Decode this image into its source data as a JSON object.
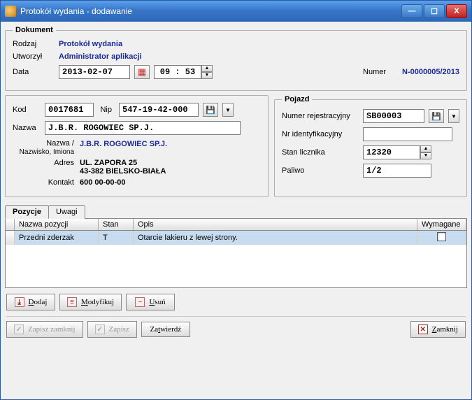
{
  "window": {
    "title": "Protokół wydania - dodawanie"
  },
  "winbuttons": {
    "min": "—",
    "max": "☐",
    "close": "X"
  },
  "dokument": {
    "legend": "Dokument",
    "rodzaj_lbl": "Rodzaj",
    "rodzaj_val": "Protokół wydania",
    "utworzyl_lbl": "Utworzył",
    "utworzyl_val": "Administrator aplikacji",
    "data_lbl": "Data",
    "data_val": "2013-02-07",
    "godz_val": "09 : 53",
    "numer_lbl": "Numer",
    "numer_val": "N-0000005/2013"
  },
  "klient": {
    "kod_lbl": "Kod",
    "kod_val": "0017681",
    "nip_lbl": "Nip",
    "nip_val": "547-19-42-000",
    "nazwa_lbl": "Nazwa",
    "nazwa_val": "J.B.R. ROGOWIEC SP.J.",
    "nazwisko_lbl1": "Nazwa /",
    "nazwisko_lbl2": "Nazwisko, Imiona",
    "nazwisko_val": "J.B.R. ROGOWIEC SP.J.",
    "adres_lbl": "Adres",
    "adres_l1": "UL. ZAPORA 25",
    "adres_l2": "43-382 BIELSKO-BIAŁA",
    "kontakt_lbl": "Kontakt",
    "kontakt_val": "600 00-00-00"
  },
  "pojazd": {
    "legend": "Pojazd",
    "rej_lbl": "Numer rejestracyjny",
    "rej_val": "SB00003",
    "ident_lbl": "Nr identyfikacyjny",
    "ident_val": "",
    "stan_lbl": "Stan licznika",
    "stan_val": "12320",
    "paliwo_lbl": "Paliwo",
    "paliwo_val": "1/2"
  },
  "tabs": {
    "pozycje": "Pozycje",
    "uwagi": "Uwagi"
  },
  "grid": {
    "cols": {
      "nazwa": "Nazwa pozycji",
      "stan": "Stan",
      "opis": "Opis",
      "wymagane": "Wymagane"
    },
    "rows": [
      {
        "nazwa": "Przedni zderzak",
        "stan": "T",
        "opis": "Otarcie lakieru z lewej strony.",
        "wymagane": false
      }
    ]
  },
  "buttons": {
    "dodaj": "Dodaj",
    "modyfikuj": "Modyfikuj",
    "usun": "Usuń",
    "zapisz_zamknij": "Zapisz zamknij",
    "zapisz": "Zapisz",
    "zatwierdz": "Zatwierdź",
    "zamknij": "Zamknij"
  }
}
